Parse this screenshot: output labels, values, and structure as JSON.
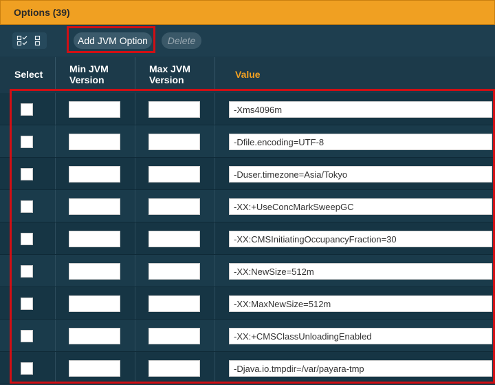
{
  "panel": {
    "title": "Options (39)"
  },
  "toolbar": {
    "add_label": "Add JVM Option",
    "delete_label": "Delete"
  },
  "table": {
    "headers": {
      "select": "Select",
      "min": "Min JVM Version",
      "max": "Max JVM Version",
      "value": "Value"
    },
    "rows": [
      {
        "min": "",
        "max": "",
        "value": "-Xms4096m"
      },
      {
        "min": "",
        "max": "",
        "value": "-Dfile.encoding=UTF-8"
      },
      {
        "min": "",
        "max": "",
        "value": "-Duser.timezone=Asia/Tokyo"
      },
      {
        "min": "",
        "max": "",
        "value": "-XX:+UseConcMarkSweepGC"
      },
      {
        "min": "",
        "max": "",
        "value": "-XX:CMSInitiatingOccupancyFraction=30"
      },
      {
        "min": "",
        "max": "",
        "value": "-XX:NewSize=512m"
      },
      {
        "min": "",
        "max": "",
        "value": "-XX:MaxNewSize=512m"
      },
      {
        "min": "",
        "max": "",
        "value": "-XX:+CMSClassUnloadingEnabled"
      },
      {
        "min": "",
        "max": "",
        "value": "-Djava.io.tmpdir=/var/payara-tmp"
      }
    ]
  },
  "colors": {
    "header_orange": "#f0a022",
    "panel_bg": "#1b3a4b",
    "highlight_red": "#d10f14"
  },
  "icons": [
    "select-all-icon",
    "deselect-all-icon"
  ]
}
